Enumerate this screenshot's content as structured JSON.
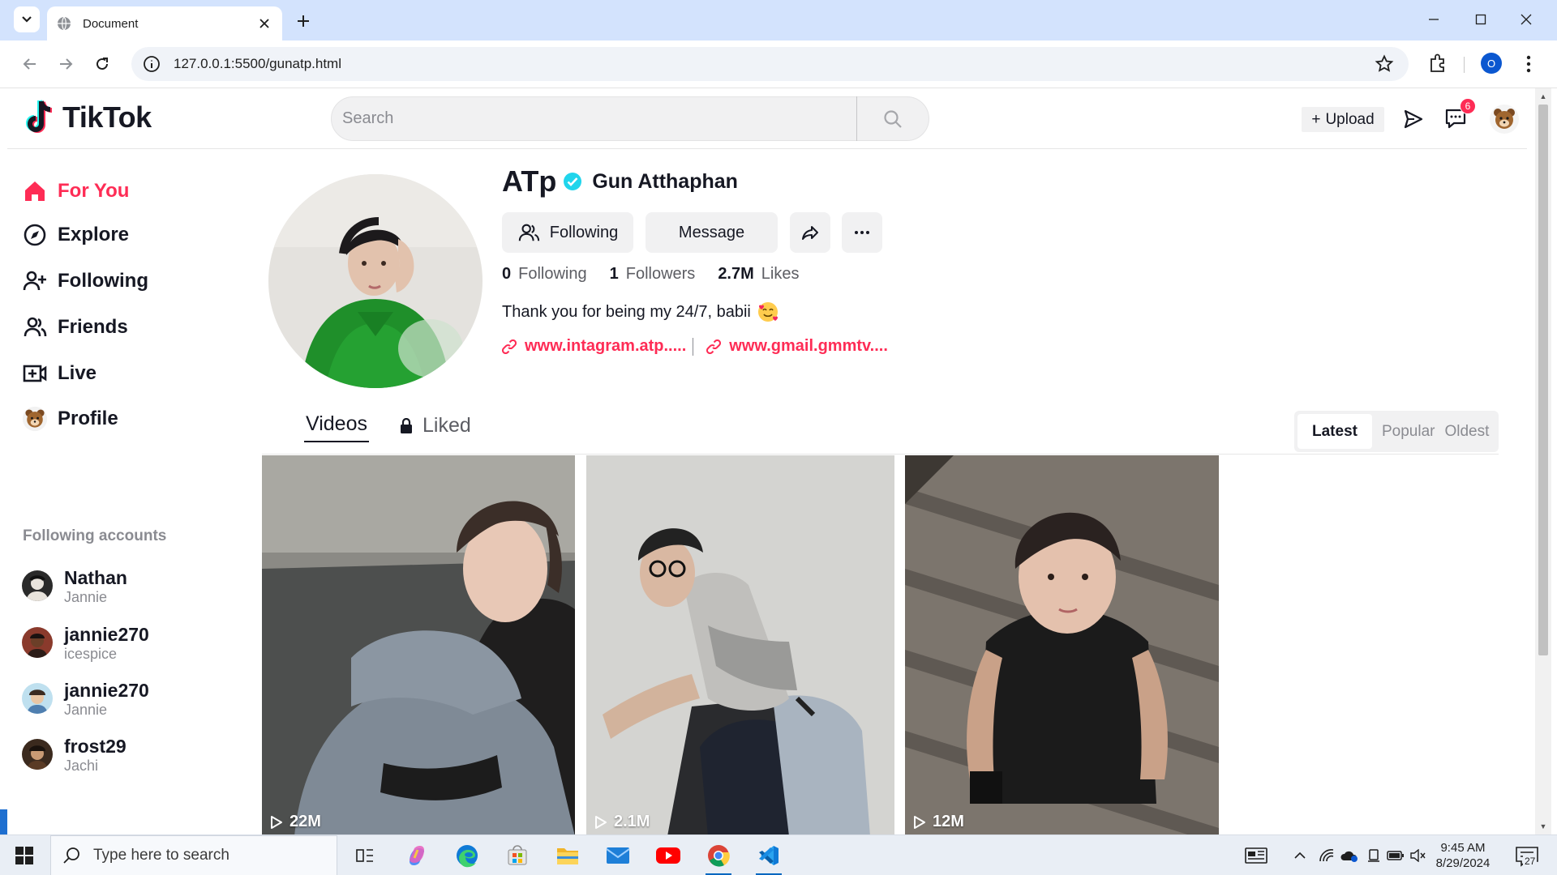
{
  "browser": {
    "tab_title": "Document",
    "url": "127.0.0.1:5500/gunatp.html",
    "profile_initial": "O"
  },
  "header": {
    "logo_text": "TikTok",
    "search_placeholder": "Search",
    "upload_label": "Upload",
    "inbox_badge": "6"
  },
  "sidebar": {
    "nav": [
      {
        "label": "For You",
        "icon": "home-icon",
        "active": true
      },
      {
        "label": "Explore",
        "icon": "compass-icon"
      },
      {
        "label": "Following",
        "icon": "user-plus-icon"
      },
      {
        "label": "Friends",
        "icon": "friends-icon"
      },
      {
        "label": "Live",
        "icon": "live-icon"
      },
      {
        "label": "Profile",
        "icon": "avatar"
      }
    ],
    "following_heading": "Following accounts",
    "accounts": [
      {
        "name": "Nathan",
        "sub": "Jannie"
      },
      {
        "name": "jannie270",
        "sub": "icespice"
      },
      {
        "name": "jannie270",
        "sub": "Jannie"
      },
      {
        "name": "frost29",
        "sub": "Jachi"
      }
    ]
  },
  "profile": {
    "username": "ATp",
    "nickname": "Gun Atthaphan",
    "following_btn": "Following",
    "message_btn": "Message",
    "stats": [
      {
        "num": "0",
        "label": "Following"
      },
      {
        "num": "1",
        "label": "Followers"
      },
      {
        "num": "2.7M",
        "label": "Likes"
      }
    ],
    "bio": "Thank you for being my 24/7, babii",
    "links": [
      "www.intagram.atp.....",
      "www.gmail.gmmtv...."
    ]
  },
  "tabs": {
    "videos": "Videos",
    "liked": "Liked",
    "sort": [
      "Latest",
      "Popular",
      "Oldest"
    ],
    "sort_active": "Latest"
  },
  "videos": [
    {
      "views": "22M"
    },
    {
      "views": "2.1M"
    },
    {
      "views": "12M"
    }
  ],
  "taskbar": {
    "search_placeholder": "Type here to search",
    "time": "9:45 AM",
    "date": "8/29/2024",
    "notification_count": "27"
  },
  "colors": {
    "accent": "#fe2c55",
    "verified": "#20d5ec",
    "chrome_tabstrip": "#d3e3fd"
  }
}
